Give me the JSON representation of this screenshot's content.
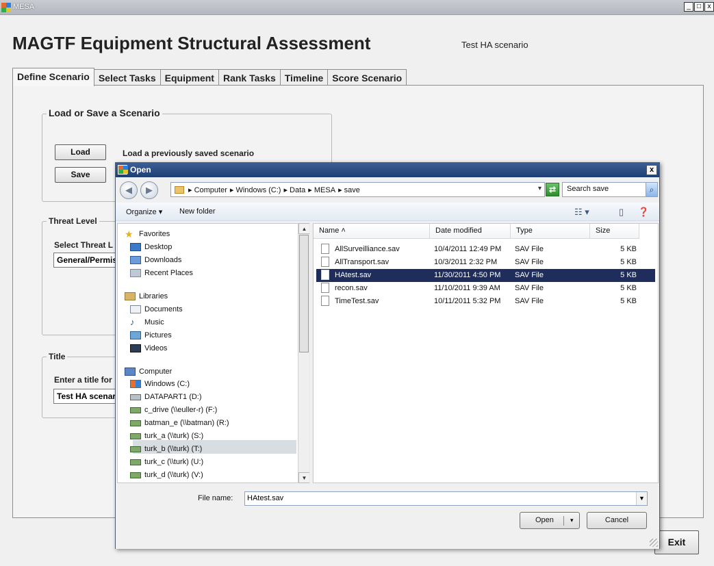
{
  "window": {
    "title": "MESA",
    "controls": [
      "_",
      "□",
      "x"
    ]
  },
  "app": {
    "heading": "MAGTF Equipment Structural Assessment",
    "scenario_title": "Test HA scenario",
    "tabs": [
      "Define Scenario",
      "Select Tasks",
      "Equipment",
      "Rank Tasks",
      "Timeline",
      "Score Scenario"
    ],
    "load_save": {
      "title": "Load or Save a Scenario",
      "load_button": "Load",
      "load_desc": "Load a previously saved scenario",
      "save_button": "Save"
    },
    "threat": {
      "title": "Threat Level",
      "select_label": "Select Threat L",
      "value": "General/Permis"
    },
    "title_group": {
      "title": "Title",
      "enter_label": "Enter a title for",
      "value": "Test HA scenar"
    },
    "exit_button": "Exit"
  },
  "dialog": {
    "title": "Open",
    "close": "x",
    "address": {
      "crumbs": [
        "▸ Computer",
        "▸ Windows (C:)",
        "▸ Data",
        "▸ MESA",
        "▸ save"
      ],
      "dropdown": "▾"
    },
    "search_placeholder": "Search save",
    "toolbar": {
      "organize": "Organize ▾",
      "new_folder": "New folder"
    },
    "nav": {
      "favorites": "Favorites",
      "desktop": "Desktop",
      "downloads": "Downloads",
      "recent": "Recent Places",
      "libraries": "Libraries",
      "documents": "Documents",
      "music": "Music",
      "pictures": "Pictures",
      "videos": "Videos",
      "computer": "Computer",
      "drives": [
        "Windows (C:)",
        "DATAPART1 (D:)",
        "c_drive (\\\\euller-r) (F:)",
        "batman_e (\\\\batman) (R:)",
        "turk_a (\\\\turk) (S:)",
        "turk_b (\\\\turk) (T:)",
        "turk_c (\\\\turk) (U:)",
        "turk_d (\\\\turk) (V:)"
      ]
    },
    "columns": {
      "name": "Name ˄",
      "date": "Date modified",
      "type": "Type",
      "size": "Size"
    },
    "files": [
      {
        "name": "AllSurveilliance.sav",
        "date": "10/4/2011 12:49 PM",
        "type": "SAV File",
        "size": "5 KB"
      },
      {
        "name": "AllTransport.sav",
        "date": "10/3/2011 2:32 PM",
        "type": "SAV File",
        "size": "5 KB"
      },
      {
        "name": "HAtest.sav",
        "date": "11/30/2011 4:50 PM",
        "type": "SAV File",
        "size": "5 KB"
      },
      {
        "name": "recon.sav",
        "date": "11/10/2011 9:39 AM",
        "type": "SAV File",
        "size": "5 KB"
      },
      {
        "name": "TimeTest.sav",
        "date": "10/11/2011 5:32 PM",
        "type": "SAV File",
        "size": "5 KB"
      }
    ],
    "file_name_label": "File name:",
    "file_name_value": "HAtest.sav",
    "open_button": "Open",
    "open_dropdown": "▾",
    "cancel_button": "Cancel"
  }
}
